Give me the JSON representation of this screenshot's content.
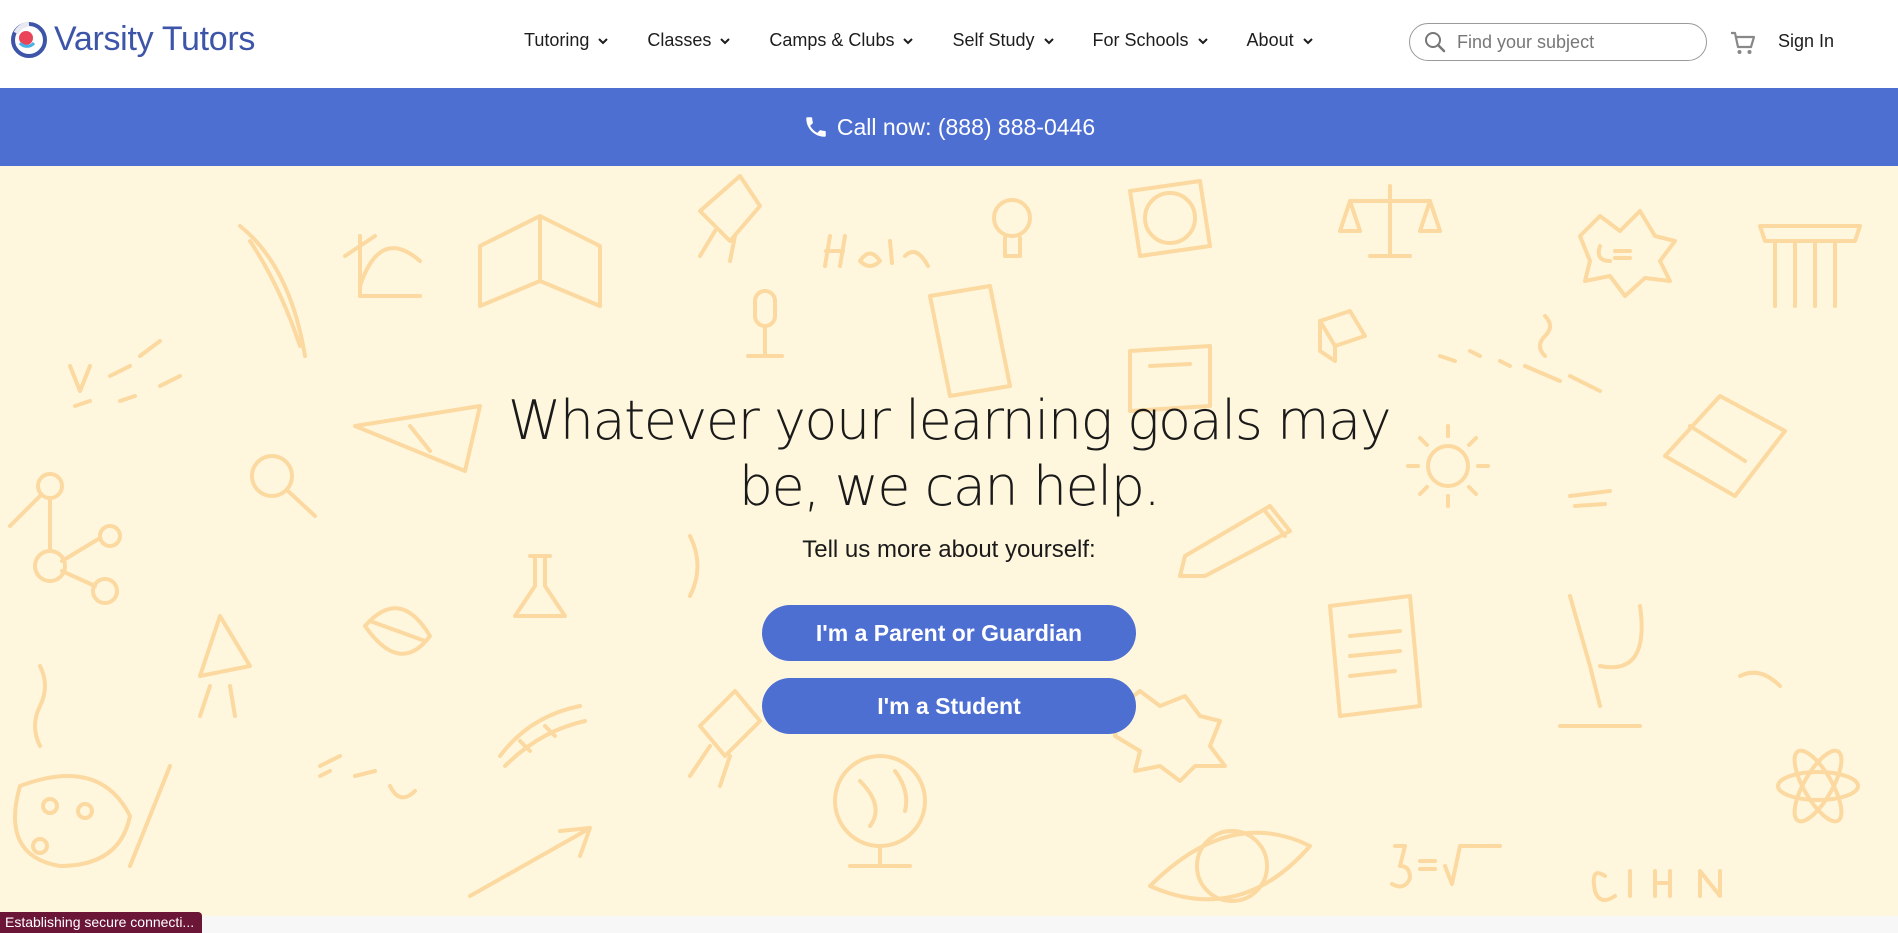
{
  "header": {
    "logo_text": "Varsity Tutors",
    "nav": [
      {
        "label": "Tutoring"
      },
      {
        "label": "Classes"
      },
      {
        "label": "Camps & Clubs"
      },
      {
        "label": "Self Study"
      },
      {
        "label": "For Schools"
      },
      {
        "label": "About"
      }
    ],
    "search": {
      "placeholder": "Find your subject",
      "value": ""
    },
    "cart_icon": "shopping-cart-icon",
    "sign_in": "Sign In"
  },
  "callbar": {
    "icon": "phone-icon",
    "text": "Call now: (888) 888-0446"
  },
  "hero": {
    "title": "Whatever your learning goals may be, we can help.",
    "subtitle": "Tell us more about yourself:",
    "parent_button": "I'm a Parent or Guardian",
    "student_button": "I'm a Student"
  },
  "status_bar": {
    "text": "Establishing secure connecti..."
  },
  "colors": {
    "brand_blue": "#4e6fd2",
    "logo_blue": "#3d55a8",
    "hero_background": "#fff7dd",
    "doodle_color": "#fbd9a0",
    "status_bar": "#6b1537"
  }
}
